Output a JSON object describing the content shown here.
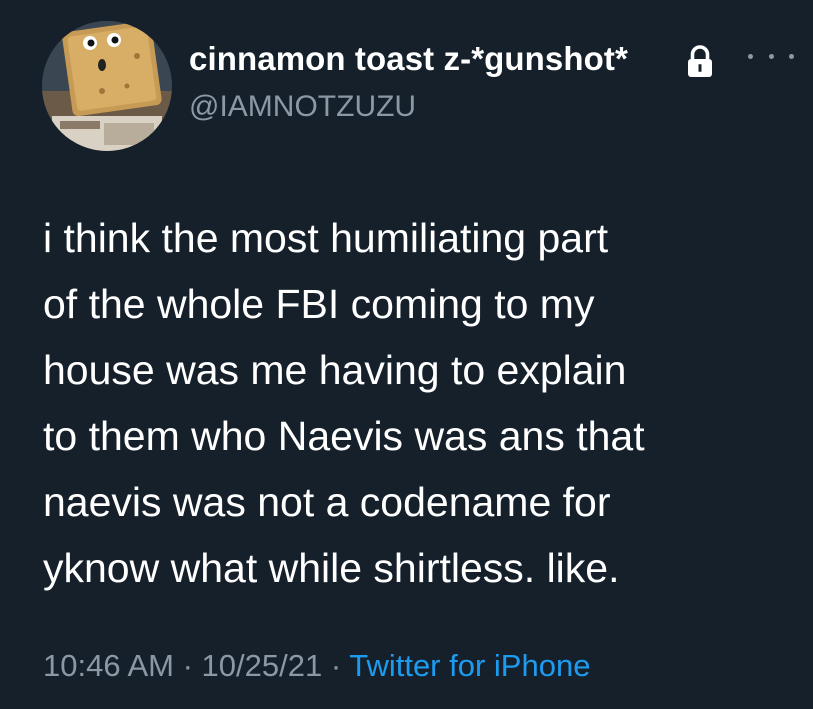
{
  "author": {
    "display_name": "cinnamon toast z-*gunshot*",
    "handle": "@IAMNOTZUZU",
    "protected_icon": "lock-icon",
    "avatar_icon": "cereal-square-avatar"
  },
  "menu_icon": "more-horizontal-icon",
  "tweet": {
    "lines": [
      "i think the most humiliating part",
      "of the whole FBI coming to my",
      "house was me having to explain",
      "to them who Naevis was ans that",
      "naevis was not a codename for",
      "yknow what while shirtless. like."
    ]
  },
  "meta": {
    "time": "10:46 AM",
    "sep1": " · ",
    "date": "10/25/21",
    "sep2": " · ",
    "source": "Twitter for iPhone"
  },
  "colors": {
    "background": "#15202b",
    "text": "#ffffff",
    "muted": "#8b98a5",
    "link": "#1d9bf0"
  }
}
